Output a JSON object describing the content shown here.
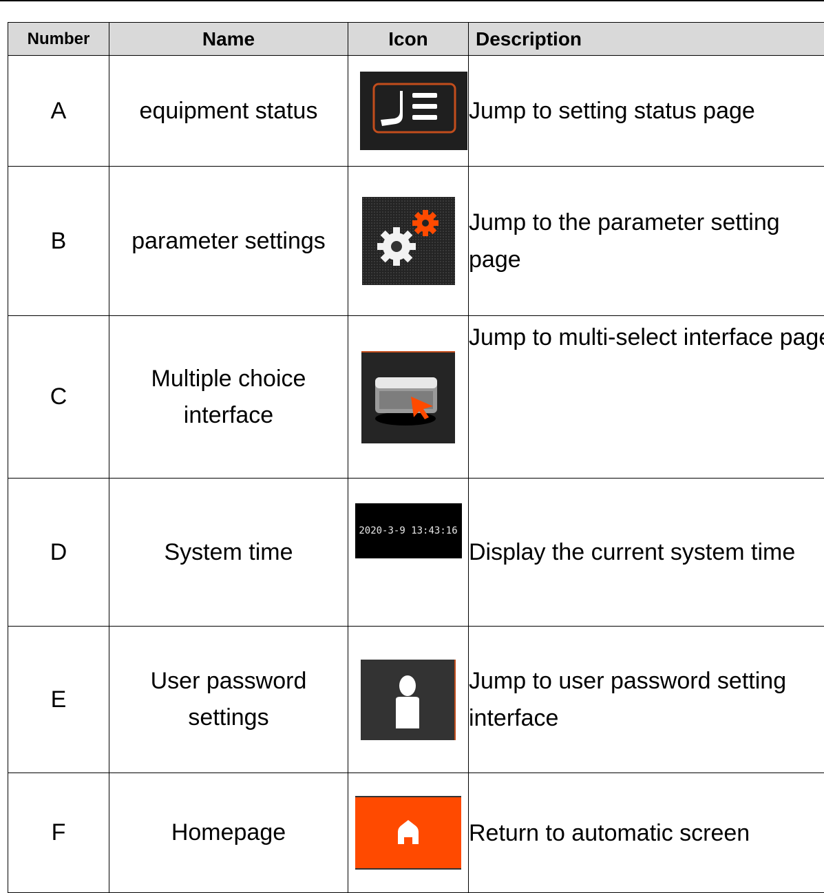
{
  "table": {
    "headers": {
      "number": "Number",
      "name": "Name",
      "icon": "Icon",
      "description": "Description"
    },
    "rows": [
      {
        "number": "A",
        "name": "equipment status",
        "icon": "equipment-status-icon",
        "description": "Jump to setting status page"
      },
      {
        "number": "B",
        "name": "parameter settings",
        "icon": "gears-icon",
        "description": "Jump to the parameter setting page"
      },
      {
        "number": "C",
        "name": "Multiple choice interface",
        "icon": "multi-select-window-icon",
        "description": "Jump to multi-select interface page"
      },
      {
        "number": "D",
        "name": "System time",
        "icon": "system-time-display",
        "time_display": "2020-3-9 13:43:16",
        "description": "Display the current system time"
      },
      {
        "number": "E",
        "name": "User password settings",
        "icon": "user-icon",
        "description": "Jump to user password setting interface"
      },
      {
        "number": "F",
        "name": "Homepage",
        "icon": "home-icon",
        "description": "Return to automatic screen"
      }
    ]
  },
  "colors": {
    "header_bg": "#d9d9d9",
    "icon_dark_bg": "#2a2a2a",
    "accent_orange": "#ff4a00",
    "border": "#000000"
  }
}
